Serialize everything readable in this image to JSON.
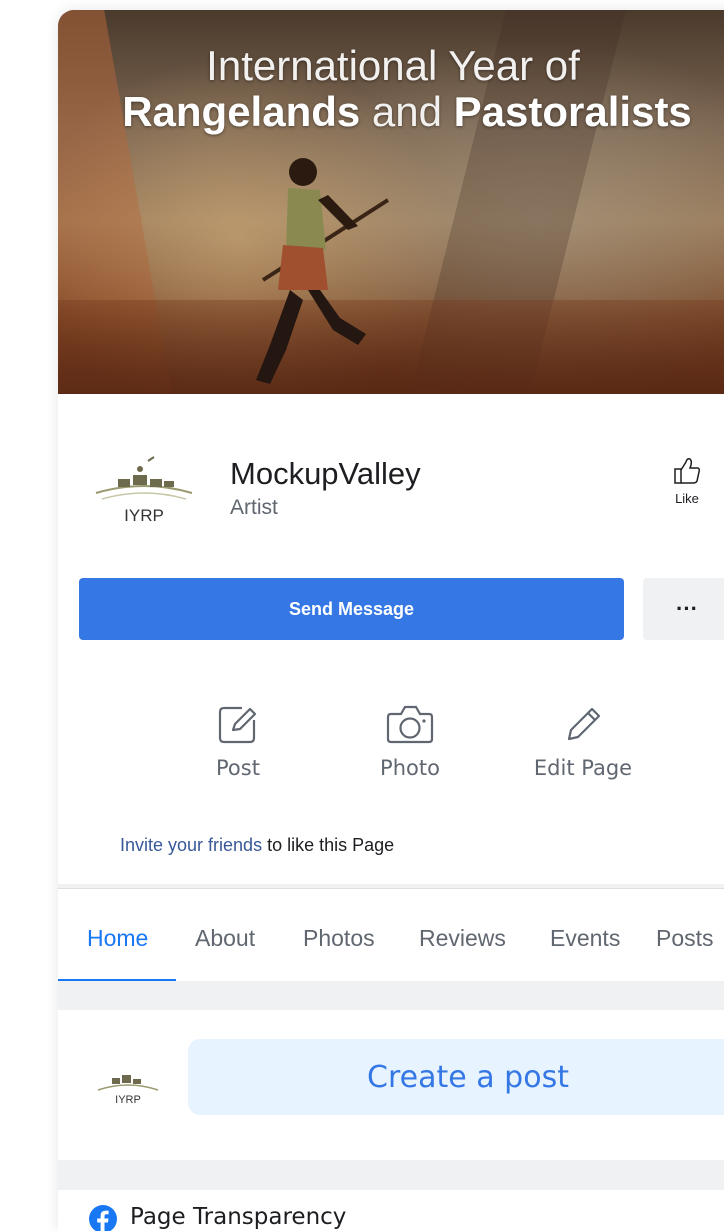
{
  "cover": {
    "title_line1": "International Year of",
    "title_word1": "Rangelands",
    "title_word2": "and",
    "title_word3": "Pastoralists"
  },
  "page": {
    "logo_text": "IYRP",
    "name": "MockupValley",
    "category": "Artist",
    "like_label": "Like"
  },
  "buttons": {
    "send_message": "Send Message",
    "more": "···"
  },
  "actions": [
    {
      "label": "Post",
      "icon": "compose-icon"
    },
    {
      "label": "Photo",
      "icon": "camera-icon"
    },
    {
      "label": "Edit Page",
      "icon": "pencil-icon"
    }
  ],
  "invite": {
    "link": "Invite your friends",
    "rest": " to like this Page"
  },
  "tabs": [
    {
      "label": "Home",
      "active": true
    },
    {
      "label": "About"
    },
    {
      "label": "Photos"
    },
    {
      "label": "Reviews"
    },
    {
      "label": "Events"
    },
    {
      "label": "Posts"
    }
  ],
  "composer": {
    "logo_text": "IYRP",
    "create_post": "Create a post"
  },
  "transparency": {
    "label": "Page Transparency",
    "icon": "facebook-icon"
  },
  "colors": {
    "accent": "#3578e5",
    "tab_active": "#1877f2",
    "link": "#385898",
    "create_bg": "#e7f3ff"
  }
}
